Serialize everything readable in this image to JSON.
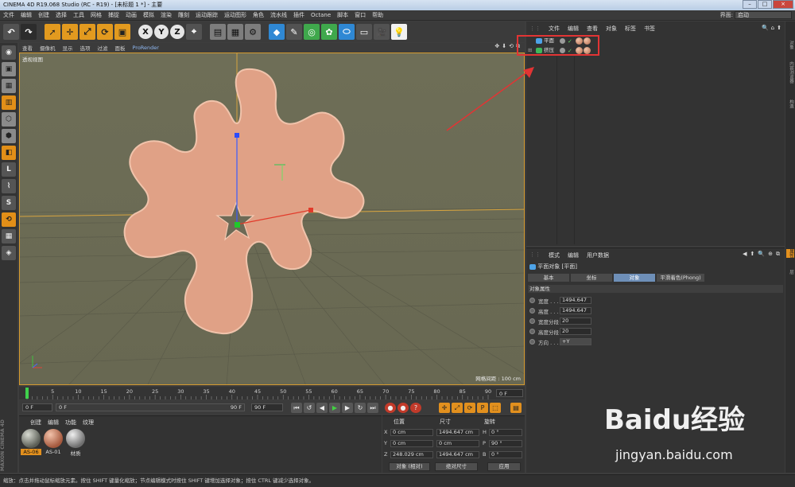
{
  "window": {
    "title": "CINEMA 4D R19.068 Studio (RC - R19) - [未标题 1 *] - 主要",
    "buttons": [
      "–",
      "□",
      "×"
    ]
  },
  "menubar": {
    "items": [
      "文件",
      "编辑",
      "创建",
      "选择",
      "工具",
      "网格",
      "捕捉",
      "动画",
      "模拟",
      "渲染",
      "雕刻",
      "运动跟踪",
      "运动图形",
      "角色",
      "流水线",
      "插件",
      "Octane",
      "脚本",
      "窗口",
      "帮助"
    ],
    "layout_label": "界面:",
    "layout_value": "启动"
  },
  "viewport": {
    "menu": [
      "查看",
      "摄像机",
      "显示",
      "选项",
      "过滤",
      "面板",
      "ProRender"
    ],
    "title": "透视视图",
    "grid_note": "网格间距 : 100 cm",
    "nav_icons": [
      "✥",
      "⬇",
      "⟲",
      "⧉"
    ]
  },
  "timeline": {
    "ticks": [
      "0",
      "5",
      "10",
      "15",
      "20",
      "25",
      "30",
      "35",
      "40",
      "45",
      "50",
      "55",
      "60",
      "65",
      "70",
      "75",
      "80",
      "85",
      "90"
    ],
    "current_frame": "0 F"
  },
  "transport": {
    "start": "0 F",
    "range_start": "0 F",
    "range_end": "90 F",
    "end": "90 F"
  },
  "materials": {
    "menu": [
      "创建",
      "编辑",
      "功能",
      "纹理"
    ],
    "items": [
      {
        "label": "AS-06",
        "selected": true,
        "color": "#8c8f86"
      },
      {
        "label": "AS-01",
        "selected": false,
        "color": "#c9866a"
      },
      {
        "label": "材质",
        "selected": false,
        "color": "#b5b5b5"
      }
    ],
    "brand": "MAXON CINEMA 4D"
  },
  "coordinates": {
    "headers": {
      "pos": "位置",
      "size": "尺寸",
      "rot": "旋转"
    },
    "rows": [
      {
        "axis": "X",
        "pos": "0 cm",
        "size": "1494.647 cm",
        "rot_label": "H",
        "rot": "0 °"
      },
      {
        "axis": "Y",
        "pos": "0 cm",
        "size": "0 cm",
        "rot_label": "P",
        "rot": "90 °"
      },
      {
        "axis": "Z",
        "pos": "248.029 cm",
        "size": "1494.647 cm",
        "rot_label": "B",
        "rot": "0 °"
      }
    ],
    "mode1": "对象 (相对)",
    "mode2": "绝对尺寸",
    "apply": "应用"
  },
  "objects": {
    "menu": [
      "文件",
      "编辑",
      "查看",
      "对象",
      "标签",
      "书签"
    ],
    "rows": [
      {
        "name": "平面",
        "color": "#4da3e8"
      },
      {
        "name": "挤压",
        "color": "#3fb85a"
      }
    ],
    "icons": [
      "🔍",
      "⌂",
      "⬆"
    ]
  },
  "right_tabs": [
    "对象",
    "内容浏览器",
    "构造",
    "属性",
    "层"
  ],
  "attributes": {
    "menu": [
      "模式",
      "编辑",
      "用户数据"
    ],
    "object": "平面对象 [平面]",
    "tabs": [
      {
        "label": "基本",
        "active": false
      },
      {
        "label": "坐标",
        "active": false
      },
      {
        "label": "对象",
        "active": true
      },
      {
        "label": "平滑着色(Phong)",
        "active": false
      }
    ],
    "section": "对象属性",
    "fields": [
      {
        "label": "宽度 . . .",
        "value": "1494.647"
      },
      {
        "label": "高度 . . .",
        "value": "1494.647"
      },
      {
        "label": "宽度分段",
        "value": "20"
      },
      {
        "label": "高度分段",
        "value": "20"
      },
      {
        "label": "方向 . . .",
        "value": "+Y"
      }
    ]
  },
  "statusbar": "缩放：点击并拖动鼠标缩放元素。按住 SHIFT 键量化缩放；节点编辑模式时按住 SHIFT 键增加选择对象；按住 CTRL 键减少选择对象。",
  "watermark": {
    "text": "Baidu经验",
    "url": "jingyan.baidu.com"
  },
  "colors": {
    "accent": "#e2901e",
    "shape_fill": "#e0a186",
    "viewport_bg": "#6b6b52",
    "highlight": "#e23434"
  }
}
